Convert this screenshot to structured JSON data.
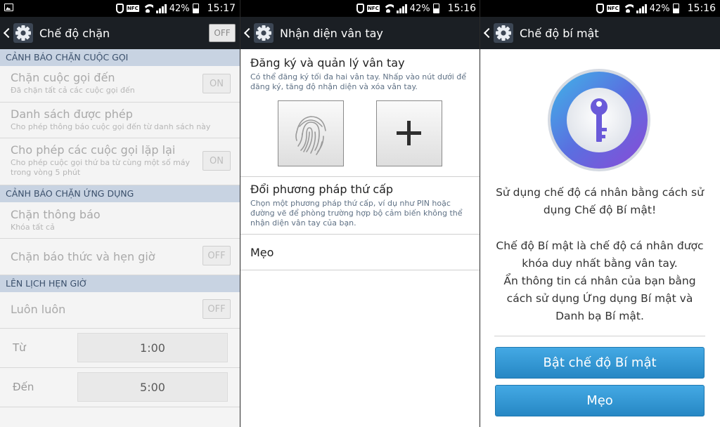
{
  "statusbar": [
    {
      "battery": "42%",
      "time": "15:17",
      "nfc": "NFC"
    },
    {
      "battery": "42%",
      "time": "15:16",
      "nfc": "NFC"
    },
    {
      "battery": "42%",
      "time": "15:16",
      "nfc": "NFC"
    }
  ],
  "call_blocking": {
    "title": "Chế độ chặn",
    "master_toggle": "OFF",
    "sections": {
      "calls": "CẢNH BÁO CHẶN CUỘC GỌI",
      "apps": "CẢNH BÁO CHẶN ỨNG DỤNG",
      "schedule": "LÊN LỊCH HẸN GIỜ"
    },
    "items": {
      "block_incoming": {
        "title": "Chặn cuộc gọi đến",
        "subtitle": "Đã chặn tất cả các cuộc gọi đến",
        "toggle": "ON"
      },
      "allowed_list": {
        "title": "Danh sách được phép",
        "subtitle": "Cho phép thông báo cuộc gọi đến từ danh sách này"
      },
      "repeat_calls": {
        "title": "Cho phép các cuộc gọi lặp lại",
        "subtitle": "Cho phép cuộc gọi thứ ba từ cùng một số máy trong vòng 5 phút",
        "toggle": "ON"
      },
      "block_notifications": {
        "title": "Chặn thông báo",
        "subtitle": "Khóa tất cả"
      },
      "block_alarms": {
        "title": "Chặn báo thức và hẹn giờ",
        "toggle": "OFF"
      },
      "always": {
        "title": "Luôn luôn",
        "toggle": "OFF"
      }
    },
    "from_label": "Từ",
    "from_value": "1:00",
    "to_label": "Đến",
    "to_value": "5:00"
  },
  "fingerprint": {
    "title": "Nhận diện vân tay",
    "register_title": "Đăng ký và quản lý vân tay",
    "register_desc": "Có thể đăng ký tối đa hai vân tay. Nhấp vào nút dưới để đăng ký, tăng độ nhận diện và xóa vân tay.",
    "add_symbol": "+",
    "secondary_title": "Đổi phương pháp thứ cấp",
    "secondary_desc": "Chọn một phương pháp thứ cấp, ví dụ như PIN hoặc đường vẽ để phòng trường hợp bộ cảm biến không thể nhận diện vân tay của bạn.",
    "tips": "Mẹo"
  },
  "private_mode": {
    "title": "Chế độ bí mật",
    "text1": "Sử dụng chế độ cá nhân bằng cách sử dụng Chế độ Bí mật!",
    "text2": "Chế độ Bí mật là chế độ cá nhân được khóa duy nhất bằng vân tay.",
    "text3": "Ẩn thông tin cá nhân của bạn bằng cách sử dụng Ứng dụng Bí mật và Danh bạ Bí mật.",
    "enable_button": "Bật chế độ Bí mật",
    "tips_button": "Mẹo"
  },
  "colors": {
    "titlebar": "#1b1f24",
    "section_header": "#c8d3e2",
    "button_blue": "#2f95d2",
    "key_ring": "#5a6fe0"
  },
  "icons": [
    "picture-icon",
    "touch-icon",
    "nfc-icon",
    "wifi-icon",
    "signal-icon",
    "battery-icon",
    "back-icon",
    "gear-icon",
    "fingerprint-icon",
    "plus-icon",
    "key-icon"
  ]
}
